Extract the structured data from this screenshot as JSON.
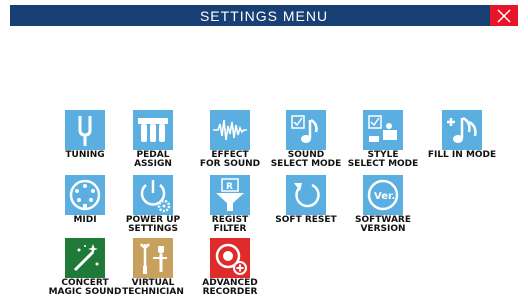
{
  "window": {
    "title": "SETTINGS MENU",
    "close_icon": "close-x-icon"
  },
  "colors": {
    "title_bar": "#173f73",
    "close_button": "#e8152a",
    "icon_blue": "#5aaee0",
    "icon_green": "#1f7a3a",
    "icon_tan": "#c9a15e",
    "icon_red": "#e02b2b"
  },
  "menu": {
    "items": [
      {
        "label": "TUNING",
        "icon": "tuning-fork-icon"
      },
      {
        "label": "PEDAL\nASSIGN",
        "icon": "pedal-icon"
      },
      {
        "label": "EFFECT\nFOR SOUND",
        "icon": "waveform-icon"
      },
      {
        "label": "SOUND\nSELECT MODE",
        "icon": "note-check-icon"
      },
      {
        "label": "STYLE\nSELECT MODE",
        "icon": "style-check-icon"
      },
      {
        "label": "FILL IN MODE",
        "icon": "fill-in-note-icon"
      },
      {
        "label": "MIDI",
        "icon": "midi-connector-icon"
      },
      {
        "label": "POWER UP\nSETTINGS",
        "icon": "power-gear-icon"
      },
      {
        "label": "REGIST\nFILTER",
        "icon": "filter-icon"
      },
      {
        "label": "SOFT RESET",
        "icon": "reset-arrow-icon"
      },
      {
        "label": "SOFTWARE\nVERSION",
        "icon": "version-icon"
      },
      {
        "label": "CONCERT\nMAGIC SOUND",
        "icon": "magic-wand-icon"
      },
      {
        "label": "VIRTUAL\nTECHNICIAN",
        "icon": "technician-tools-icon"
      },
      {
        "label": "ADVANCED\nRECORDER",
        "icon": "record-plus-icon"
      }
    ]
  }
}
